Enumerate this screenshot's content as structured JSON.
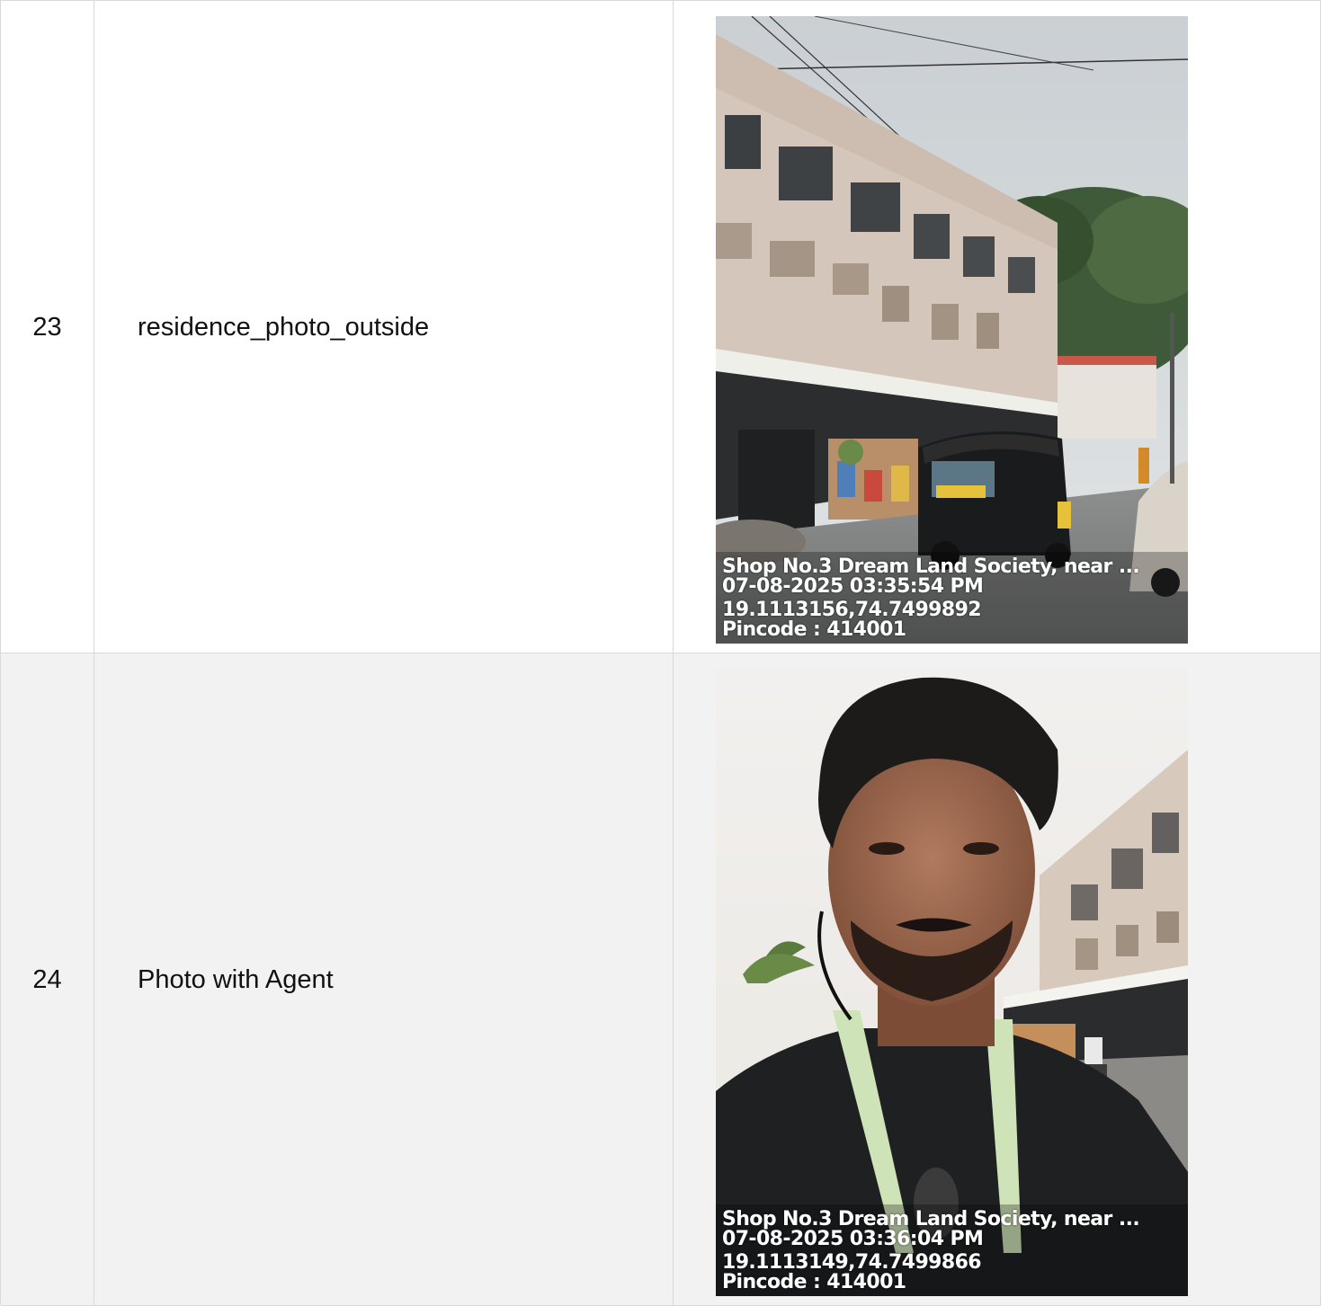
{
  "rows": [
    {
      "number": "23",
      "label": "residence_photo_outside",
      "photo": {
        "subject": "building-exterior-street",
        "caption": {
          "address": "Shop No.3 Dream Land Society, near ...",
          "datetime": "07-08-2025 03:35:54 PM",
          "coords": "19.1113156,74.7499892",
          "pincode": "Pincode : 414001"
        }
      }
    },
    {
      "number": "24",
      "label": "Photo with Agent",
      "photo": {
        "subject": "agent-selfie",
        "caption": {
          "address": "Shop No.3 Dream Land Society, near ...",
          "datetime": "07-08-2025 03:36:04 PM",
          "coords": "19.1113149,74.7499866",
          "pincode": "Pincode : 414001"
        }
      }
    }
  ],
  "colors": {
    "border": "#d9d9d9",
    "row_alt_bg": "#f2f2f2",
    "text": "#111111"
  }
}
